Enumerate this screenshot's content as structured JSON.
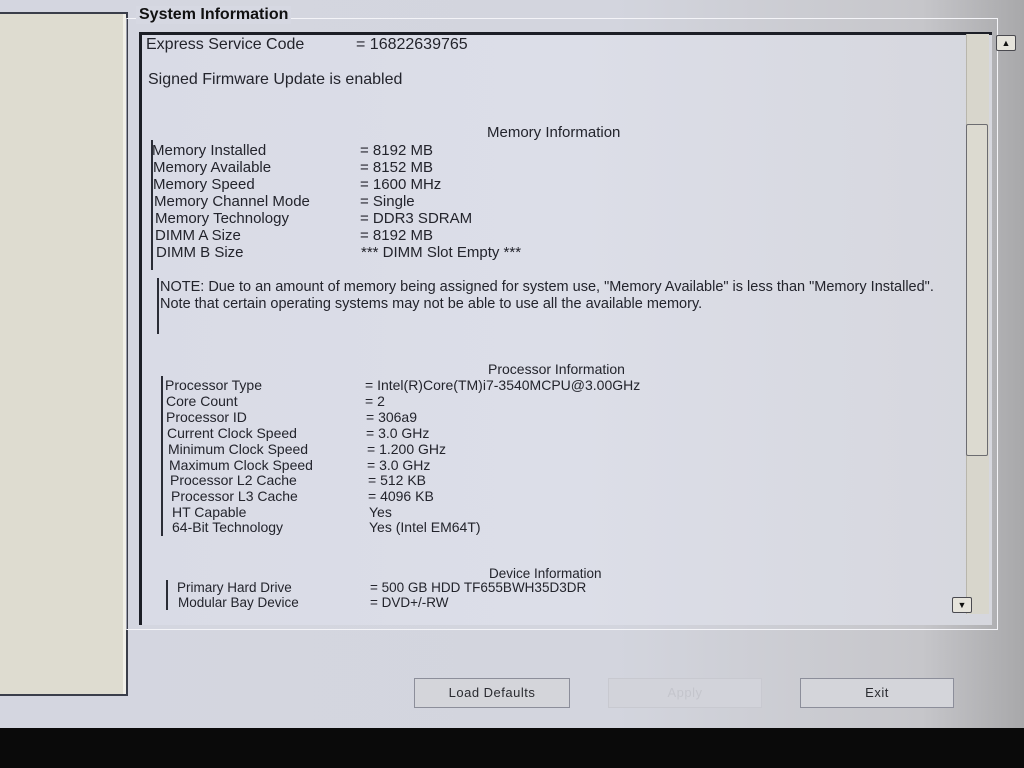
{
  "groupbox_title": "System Information",
  "header": [
    {
      "label": "Express Service Code",
      "value": "= 16822639765"
    },
    {
      "label": "Signed Firmware Update is enabled",
      "value": ""
    }
  ],
  "memory": {
    "heading": "Memory Information",
    "rows": [
      {
        "label": "Memory Installed",
        "value": "= 8192 MB"
      },
      {
        "label": "Memory Available",
        "value": "= 8152 MB"
      },
      {
        "label": "Memory Speed",
        "value": "= 1600 MHz"
      },
      {
        "label": "Memory Channel Mode",
        "value": "= Single"
      },
      {
        "label": "Memory Technology",
        "value": "= DDR3 SDRAM"
      },
      {
        "label": "DIMM A Size",
        "value": "= 8192 MB"
      },
      {
        "label": "DIMM B Size",
        "value": "*** DIMM Slot Empty ***"
      }
    ],
    "note": "NOTE: Due to an amount of memory being assigned for system use, \"Memory Available\" is less than \"Memory Installed\". Note that certain operating systems may not be able to use all the available memory."
  },
  "processor": {
    "heading": "Processor Information",
    "rows": [
      {
        "label": "Processor Type",
        "value": "= Intel(R)Core(TM)i7-3540MCPU@3.00GHz"
      },
      {
        "label": "Core Count",
        "value": "= 2"
      },
      {
        "label": "Processor ID",
        "value": "= 306a9"
      },
      {
        "label": "Current Clock Speed",
        "value": "= 3.0 GHz"
      },
      {
        "label": "Minimum Clock Speed",
        "value": "= 1.200 GHz"
      },
      {
        "label": "Maximum Clock Speed",
        "value": "= 3.0 GHz"
      },
      {
        "label": "Processor L2 Cache",
        "value": "= 512 KB"
      },
      {
        "label": "Processor L3 Cache",
        "value": "= 4096 KB"
      },
      {
        "label": "HT Capable",
        "value": "Yes"
      },
      {
        "label": "64-Bit Technology",
        "value": "Yes (Intel EM64T)"
      }
    ]
  },
  "device": {
    "heading": "Device Information",
    "rows": [
      {
        "label": "Primary Hard Drive",
        "value": "= 500 GB HDD TF655BWH35D3DR"
      },
      {
        "label": "Modular Bay Device",
        "value": "= DVD+/-RW"
      }
    ]
  },
  "scrollbar": {
    "up_icon": "▲",
    "down_icon": "▼"
  },
  "buttons": {
    "load_defaults": "Load Defaults",
    "apply": "Apply",
    "exit": "Exit"
  }
}
